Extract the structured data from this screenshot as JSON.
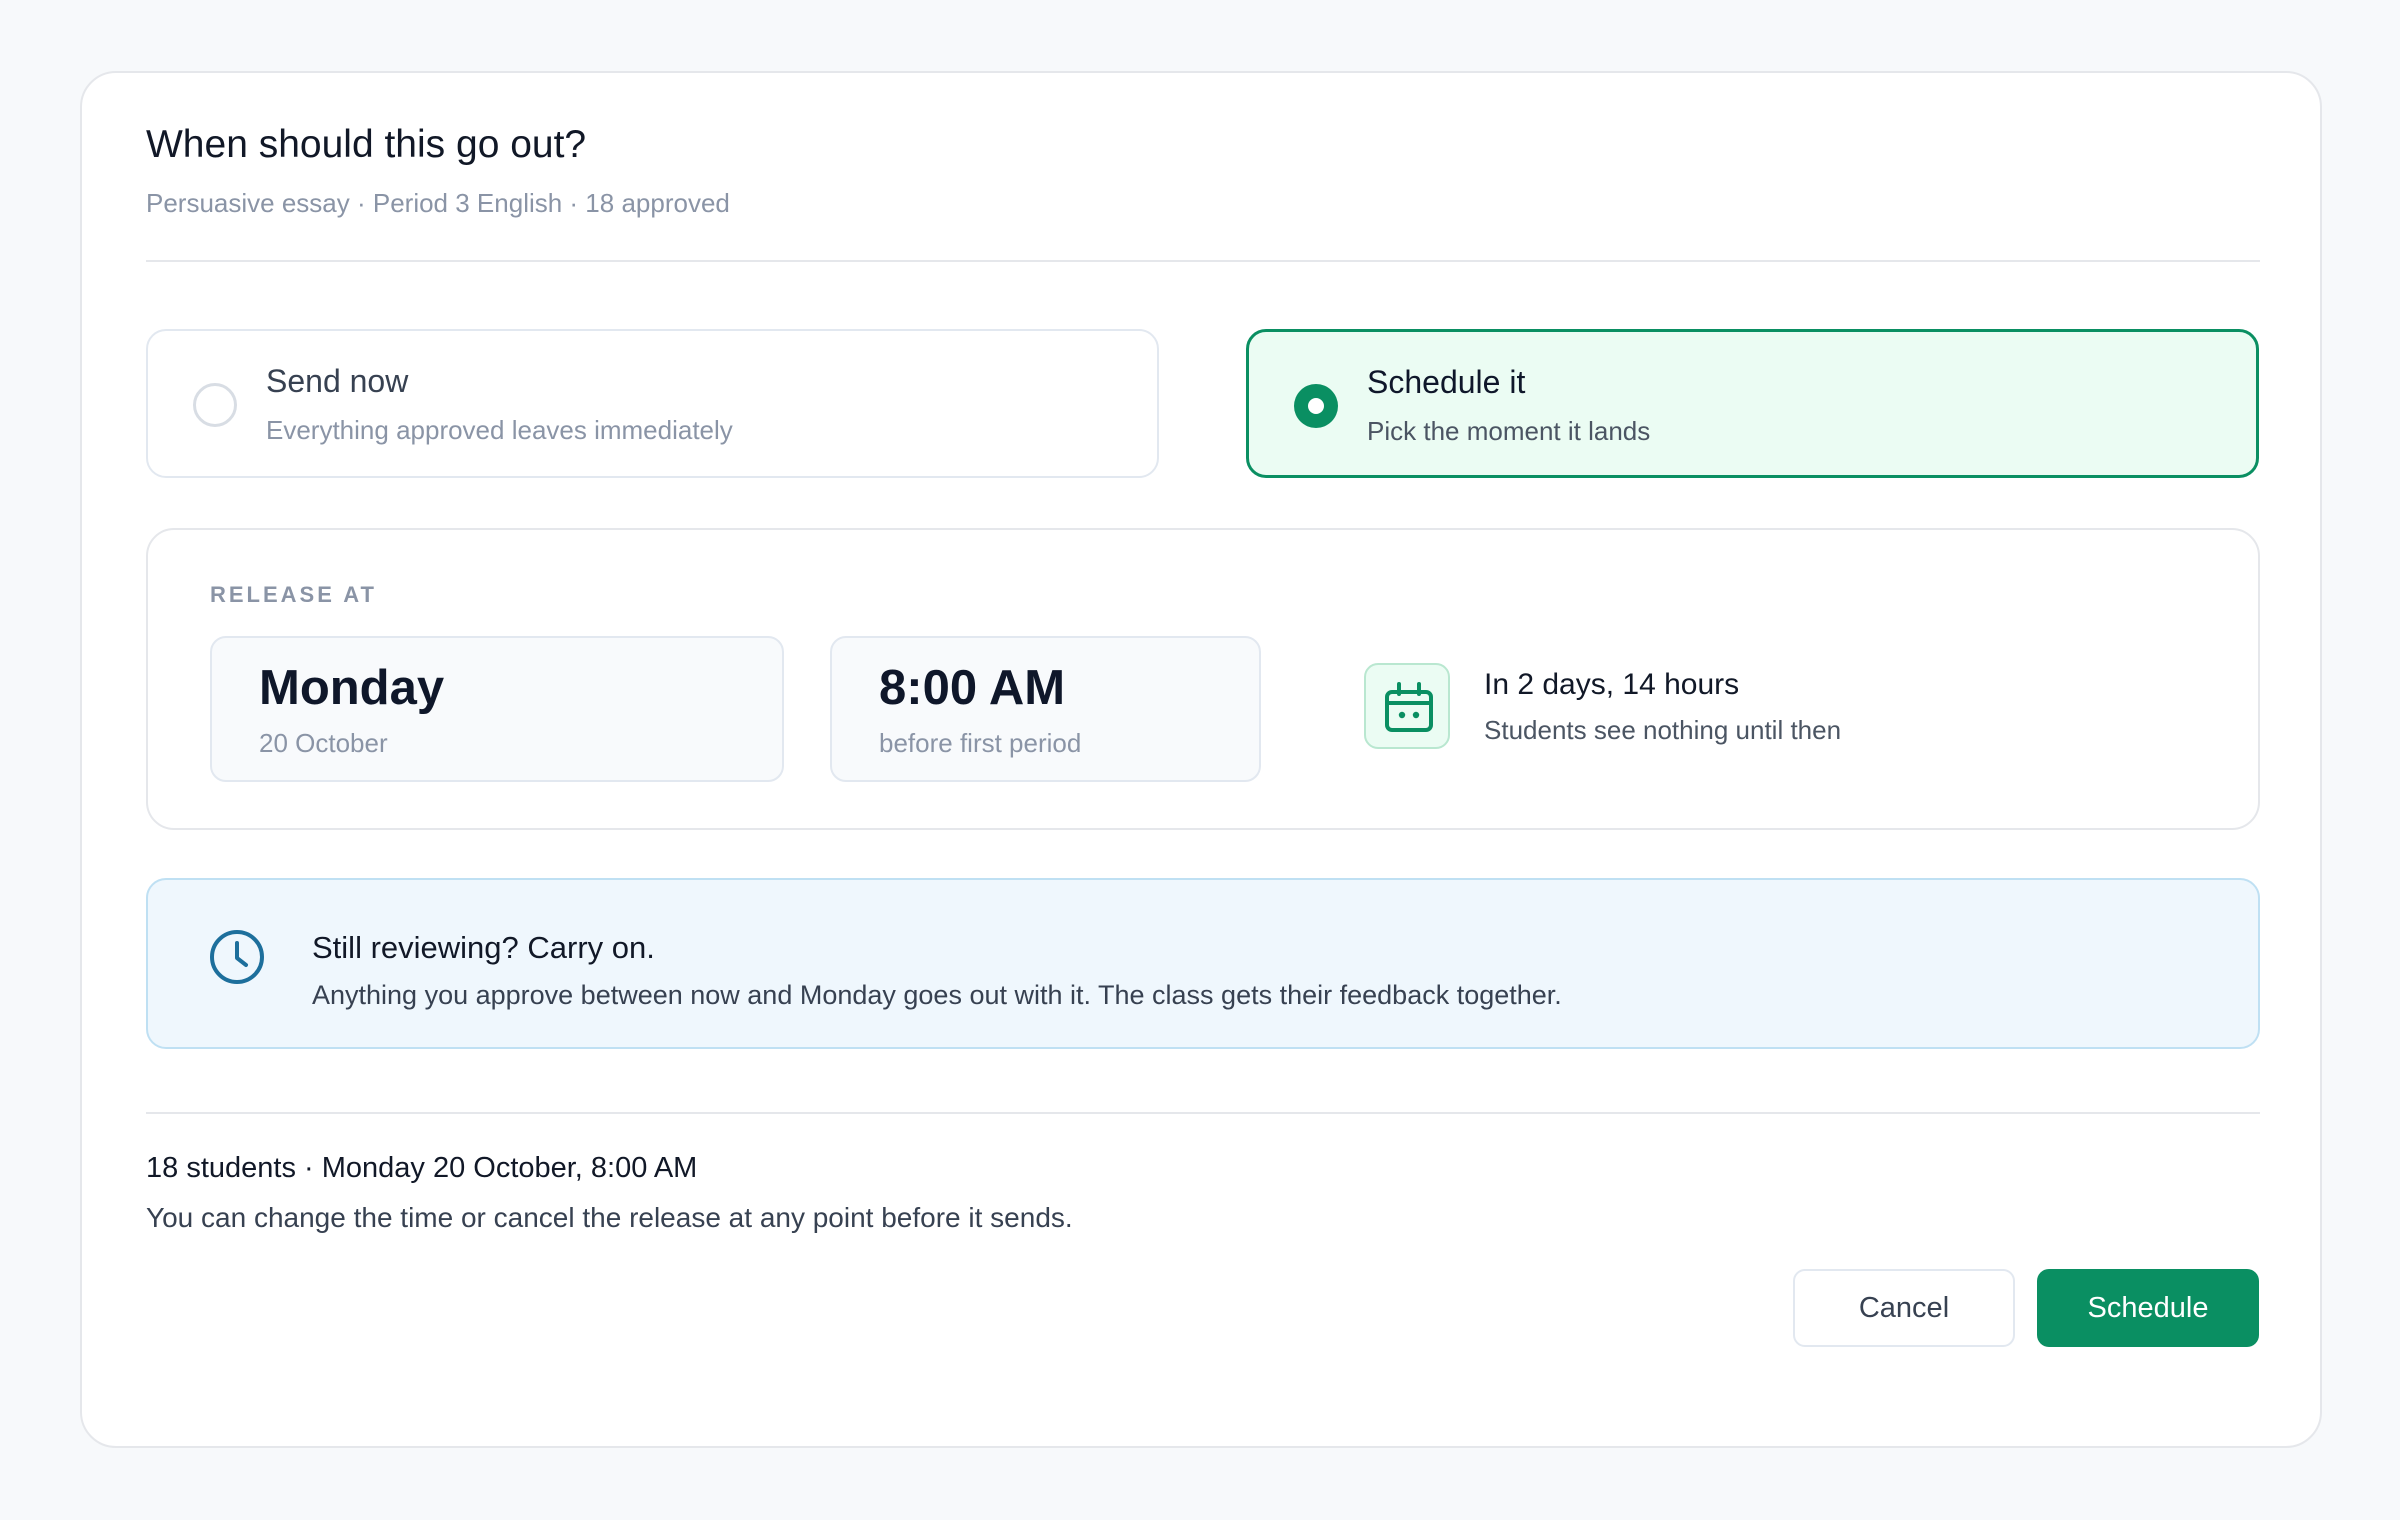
{
  "dialog": {
    "title": "When should this go out?",
    "subtitle": "Persuasive essay · Period 3 English · 18 approved"
  },
  "options": {
    "send_now": {
      "title": "Send now",
      "description": "Everything approved leaves immediately",
      "selected": false
    },
    "schedule": {
      "title": "Schedule it",
      "description": "Pick the moment it lands",
      "selected": true
    }
  },
  "release": {
    "label": "RELEASE AT",
    "day": "Monday",
    "date": "20 October",
    "time": "8:00 AM",
    "time_note": "before first period",
    "countdown": "In 2 days, 14 hours",
    "countdown_note": "Students see nothing until then",
    "icon": "calendar-icon"
  },
  "notice": {
    "icon": "clock-icon",
    "title": "Still reviewing? Carry on.",
    "body": "Anything you approve between now and Monday goes out with it. The class gets their feedback together."
  },
  "summary": {
    "line": "18 students · Monday 20 October, 8:00 AM",
    "note": "You can change the time or cancel the release at any point before it sends."
  },
  "buttons": {
    "cancel": "Cancel",
    "schedule": "Schedule"
  },
  "colors": {
    "accent": "#0a8f62",
    "accent_bg": "#ebfcf3",
    "info_bg": "#eff7fd",
    "info_icon": "#1d6f9c"
  }
}
